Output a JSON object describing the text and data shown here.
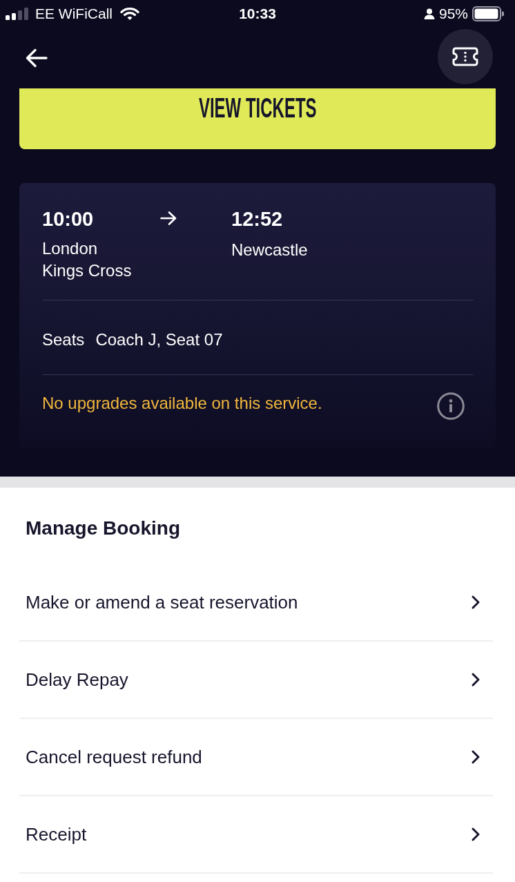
{
  "status_bar": {
    "carrier": "EE WiFiCall",
    "time": "10:33",
    "battery": "95%"
  },
  "view_tickets_button": {
    "label": "VIEW TICKETS"
  },
  "journey": {
    "departure": {
      "time": "10:00",
      "station": "London Kings Cross"
    },
    "arrival": {
      "time": "12:52",
      "station": "Newcastle"
    },
    "seats": {
      "label": "Seats",
      "value": "Coach J, Seat 07"
    },
    "notice": "No upgrades available on this service."
  },
  "manage_booking": {
    "title": "Manage Booking",
    "items": [
      {
        "label": "Make or amend a seat reservation"
      },
      {
        "label": "Delay Repay"
      },
      {
        "label": "Cancel request refund"
      },
      {
        "label": "Receipt"
      }
    ]
  }
}
